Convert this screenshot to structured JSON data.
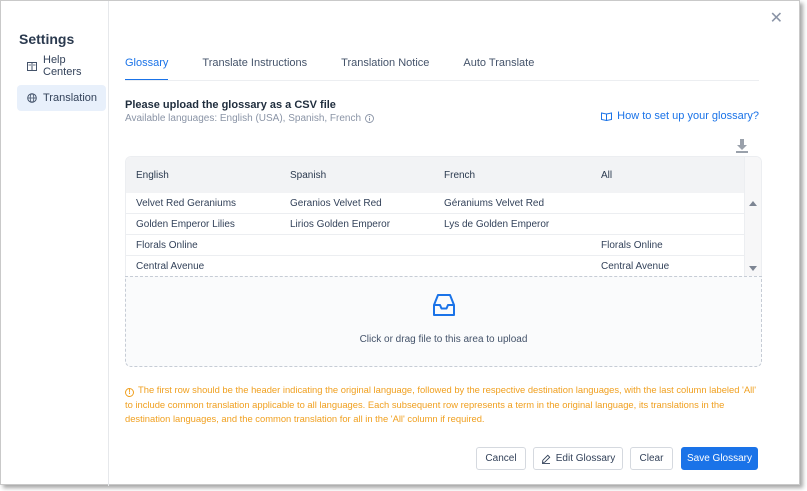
{
  "sidebar": {
    "title": "Settings",
    "items": [
      {
        "label": "Help Centers",
        "icon": "book-icon"
      },
      {
        "label": "Translation",
        "icon": "globe-icon",
        "active": true
      }
    ]
  },
  "tabs": [
    {
      "label": "Glossary",
      "active": true
    },
    {
      "label": "Translate Instructions"
    },
    {
      "label": "Translation Notice"
    },
    {
      "label": "Auto Translate"
    }
  ],
  "upload": {
    "title": "Please upload the glossary as a CSV file",
    "available": "Available languages: English (USA), Spanish, French",
    "howto_link": "How to set up your glossary?"
  },
  "table": {
    "headers": [
      "English",
      "Spanish",
      "French",
      "All"
    ],
    "rows": [
      [
        "Velvet Red Geraniums",
        "Geranios Velvet Red",
        "Géraniums Velvet Red",
        ""
      ],
      [
        "Golden Emperor Lilies",
        "Lirios Golden Emperor",
        "Lys de Golden Emperor",
        ""
      ],
      [
        "Florals Online",
        "",
        "",
        "Florals Online"
      ],
      [
        "Central Avenue",
        "",
        "",
        "Central Avenue"
      ]
    ]
  },
  "dropzone": {
    "text": "Click or drag file to this area to upload"
  },
  "note": "The first row should be the header indicating the original language, followed by the respective destination languages, with the last column labeled 'All' to include common translation applicable to all languages. Each subsequent row represents a term in the original language, its translations in the destination languages, and the common translation for all in the 'All' column if required.",
  "buttons": {
    "cancel": "Cancel",
    "edit": "Edit Glossary",
    "clear": "Clear",
    "save": "Save Glossary"
  },
  "colors": {
    "accent": "#1a73e8",
    "warning": "#f0a020"
  }
}
